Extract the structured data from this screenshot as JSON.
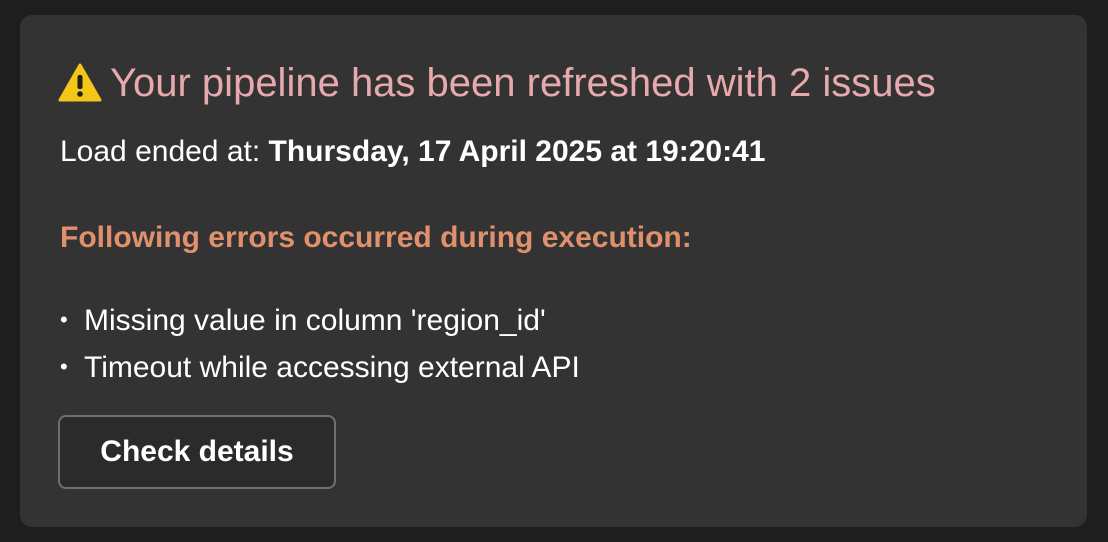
{
  "notification": {
    "warning_icon": "warning-icon",
    "title": "Your pipeline has been refreshed with 2 issues",
    "load_label": "Load ended at:",
    "load_value": "Thursday, 17 April 2025 at 19:20:41",
    "errors_heading": "Following errors occurred during execution:",
    "bullet": "•",
    "errors": [
      "Missing value in column 'region_id'",
      "Timeout while accessing external API"
    ],
    "button_label": "Check details"
  },
  "colors": {
    "background": "#1e1e1e",
    "card": "#333333",
    "title": "#e8a9ad",
    "errors_heading": "#e0906c",
    "warning_icon": "#f5c518",
    "button_border": "#6f6f6f"
  }
}
